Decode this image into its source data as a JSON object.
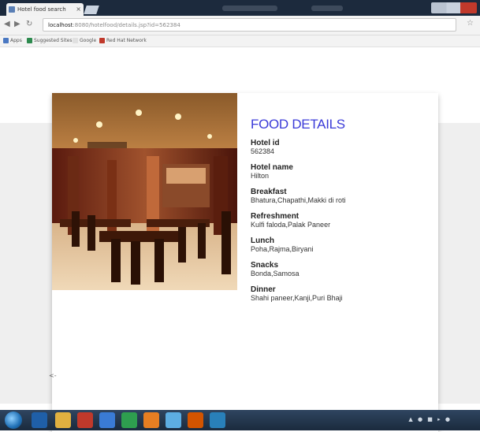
{
  "browser": {
    "tab_title": "Hotel food search",
    "tab_close": "×",
    "address_host": "localhost",
    "address_rest": ":8080/hotelfood/details.jsp?id=562384",
    "bookmarks": [
      "Apps",
      "Suggested Sites",
      "Google",
      "Red Hat Network"
    ]
  },
  "page": {
    "heading": "FOOD DETAILS",
    "fields": [
      {
        "label": "Hotel id",
        "value": "562384"
      },
      {
        "label": "Hotel name",
        "value": "Hilton"
      },
      {
        "label": "Breakfast",
        "value": "Bhatura,Chapathi,Makki di roti"
      },
      {
        "label": "Refreshment",
        "value": "Kulfi faloda,Palak Paneer"
      },
      {
        "label": "Lunch",
        "value": "Poha,Rajma,Biryani"
      },
      {
        "label": "Snacks",
        "value": "Bonda,Samosa"
      },
      {
        "label": "Dinner",
        "value": "Shahi paneer,Kanji,Puri Bhaji"
      }
    ],
    "back_link": "<-"
  },
  "colors": {
    "heading": "#3b3bd8",
    "band": "#efefef",
    "taskbar": "#1a2a3d"
  }
}
